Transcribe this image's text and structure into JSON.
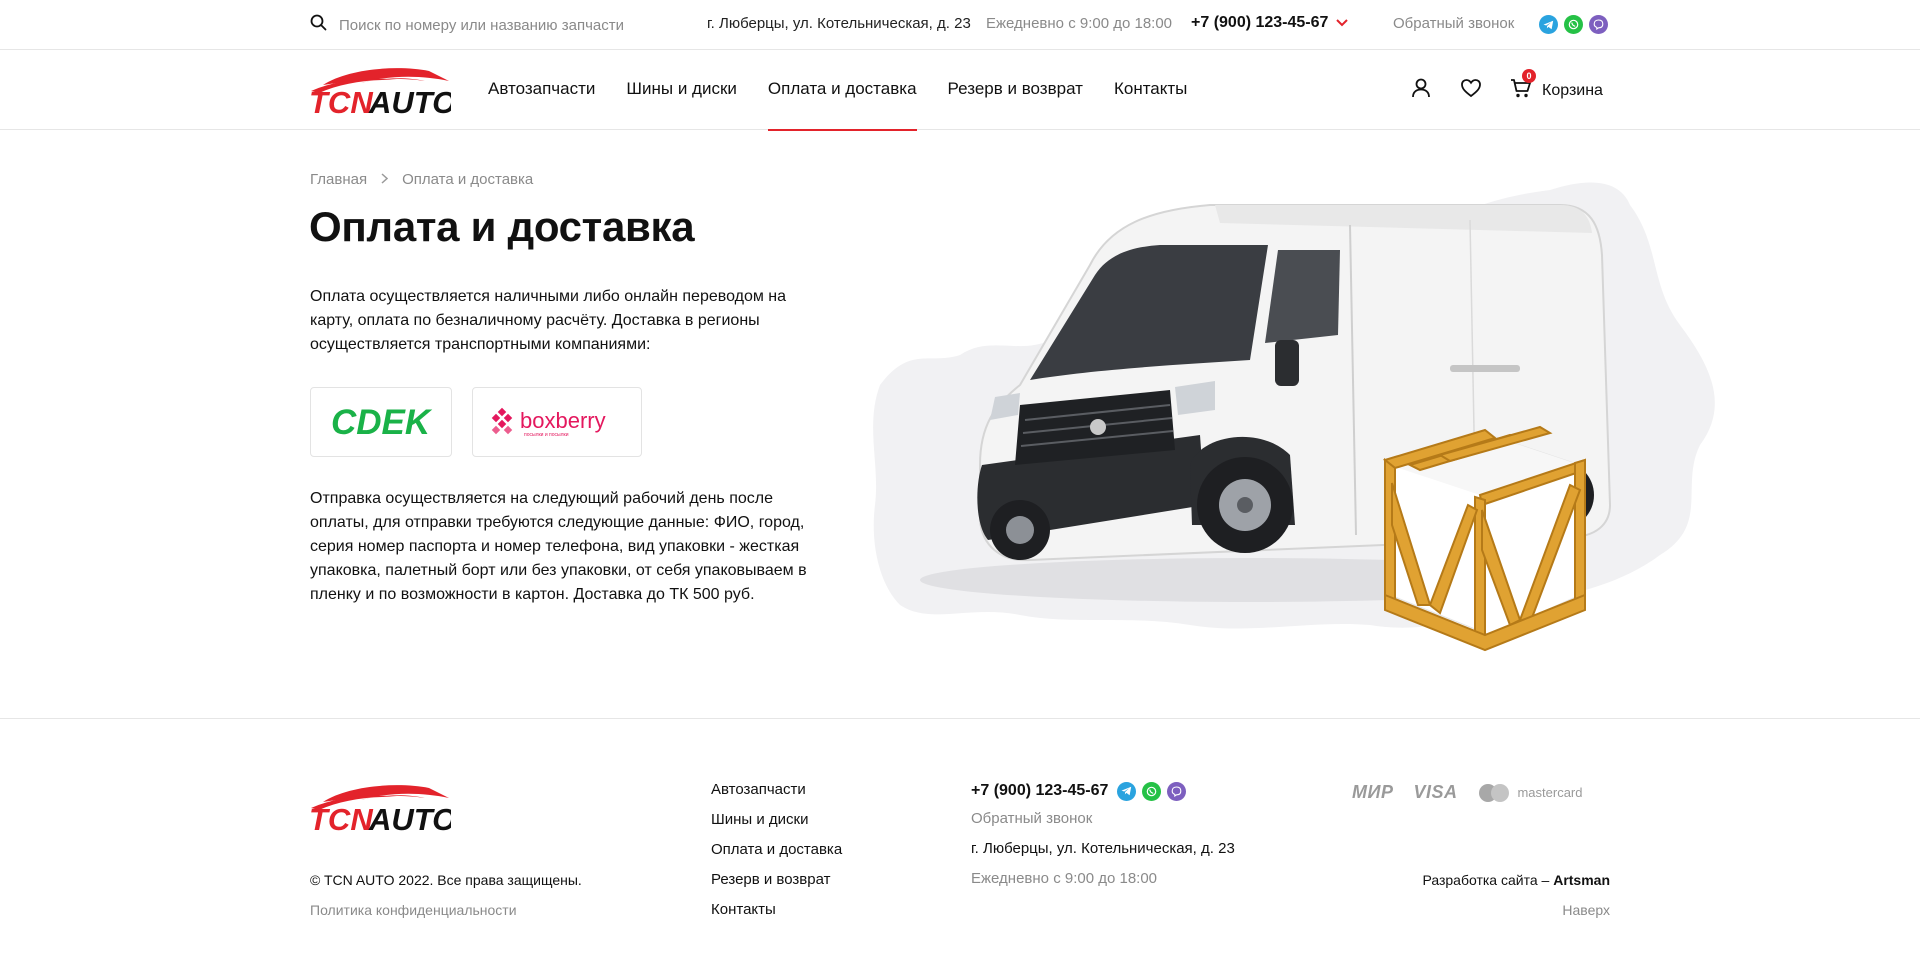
{
  "topbar": {
    "search_placeholder": "Поиск по номеру или названию запчасти",
    "address": "г. Люберцы, ул. Котельническая, д. 23",
    "hours": "Ежедневно с 9:00 до 18:00",
    "phone": "+7 (900) 123-45-67",
    "callback": "Обратный звонок",
    "messengers": [
      "telegram-icon",
      "whatsapp-icon",
      "viber-icon"
    ]
  },
  "header": {
    "logo_text": "TCN AUTO",
    "nav": [
      {
        "label": "Автозапчасти",
        "active": false
      },
      {
        "label": "Шины и диски",
        "active": false
      },
      {
        "label": "Оплата и доставка",
        "active": true
      },
      {
        "label": "Резерв и возврат",
        "active": false
      },
      {
        "label": "Контакты",
        "active": false
      }
    ],
    "cart_label": "Корзина",
    "cart_count": "0"
  },
  "breadcrumb": {
    "home": "Главная",
    "current": "Оплата и доставка"
  },
  "main": {
    "title": "Оплата и доставка",
    "intro": "Оплата осуществляется наличными либо онлайн переводом на карту, оплата по безналичному расчёту. Доставка в регионы осуществляется транспортными компаниями:",
    "partners": [
      {
        "name": "CDEK",
        "logo_text": "CDEK"
      },
      {
        "name": "boxberry",
        "logo_text": "boxberry",
        "tagline": "посылки и посылки"
      }
    ],
    "shipping": "Отправка осуществляется на следующий рабочий день после оплаты, для отправки требуются следующие данные: ФИО, город, серия номер паспорта и номер телефона, вид упаковки - жесткая упаковка, палетный борт или без упаковки, от себя упаковываем в пленку и по возможности в картон. Доставка до ТК 500 руб."
  },
  "footer": {
    "copyright": "© TCN AUTO 2022. Все права защищены.",
    "privacy": "Политика конфиденциальности",
    "links": [
      "Автозапчасти",
      "Шины и диски",
      "Оплата и доставка",
      "Резерв и возврат",
      "Контакты"
    ],
    "phone": "+7 (900) 123-45-67",
    "callback": "Обратный звонок",
    "address": "г. Люберцы, ул. Котельническая, д. 23",
    "hours": "Ежедневно с 9:00 до 18:00",
    "payments": [
      "МИР",
      "VISA",
      "mastercard"
    ],
    "dev_prefix": "Разработка сайта – ",
    "dev_name": "Artsman",
    "up": "Наверх"
  },
  "colors": {
    "accent": "#e3232b",
    "text": "#111111",
    "muted": "#8a8a8a",
    "cdek_green": "#1ab248",
    "boxberry_pink": "#e4185e"
  }
}
